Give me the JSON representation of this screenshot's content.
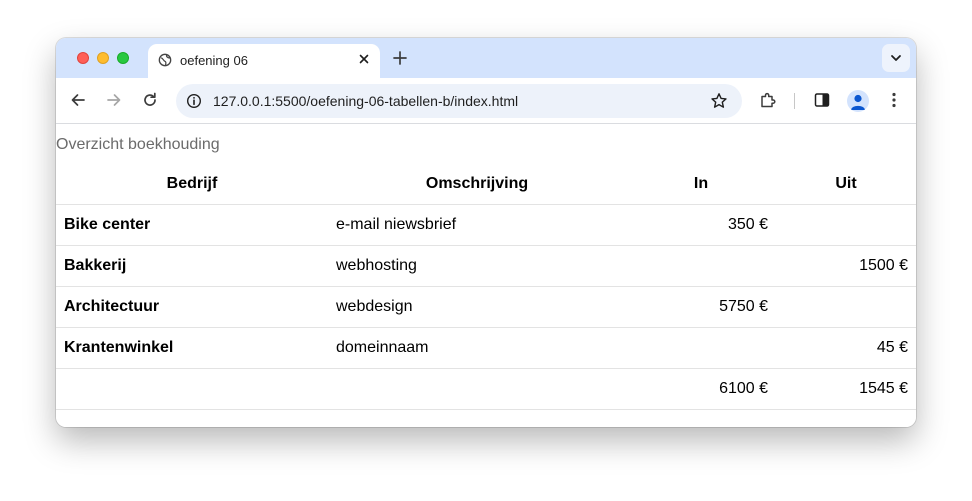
{
  "browser": {
    "tab_title": "oefening 06",
    "url": "127.0.0.1:5500/oefening-06-tabellen-b/index.html"
  },
  "page": {
    "caption": "Overzicht boekhouding",
    "headers": {
      "bedrijf": "Bedrijf",
      "omschrijving": "Omschrijving",
      "in": "In",
      "uit": "Uit"
    },
    "rows": [
      {
        "bedrijf": "Bike center",
        "omschrijving": "e-mail niewsbrief",
        "in": "350 €",
        "uit": ""
      },
      {
        "bedrijf": "Bakkerij",
        "omschrijving": "webhosting",
        "in": "",
        "uit": "1500 €"
      },
      {
        "bedrijf": "Architectuur",
        "omschrijving": "webdesign",
        "in": "5750 €",
        "uit": ""
      },
      {
        "bedrijf": "Krantenwinkel",
        "omschrijving": "domeinnaam",
        "in": "",
        "uit": "45 €"
      }
    ],
    "totals": {
      "in": "6100 €",
      "uit": "1545 €"
    }
  },
  "icons": {
    "favicon": "globe-icon",
    "close": "close-icon",
    "new_tab": "plus-icon",
    "tab_menu": "chevron-down-icon",
    "back": "back-arrow-icon",
    "forward": "forward-arrow-icon",
    "reload": "reload-icon",
    "site_info": "info-icon",
    "bookmark": "star-icon",
    "extensions": "puzzle-icon",
    "side_panel": "side-panel-icon",
    "profile": "person-icon",
    "menu": "kebab-menu-icon"
  },
  "colors": {
    "tabstrip": "#d3e3fd",
    "omnibox": "#edf2fa",
    "caption_text": "#6b6b6b",
    "row_border": "#e3e3e3"
  }
}
